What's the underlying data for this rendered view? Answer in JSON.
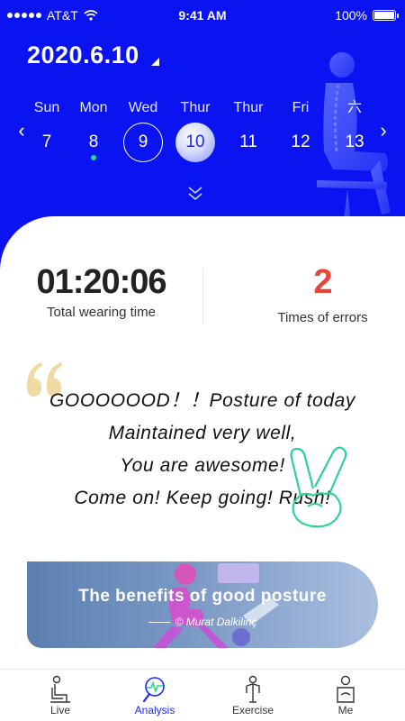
{
  "status_bar": {
    "carrier": "AT&T",
    "time": "9:41 AM",
    "battery": "100%"
  },
  "header": {
    "date": "2020.6.10",
    "prev_arrow": "‹",
    "next_arrow": "›",
    "days": [
      {
        "name": "Sun",
        "number": "7"
      },
      {
        "name": "Mon",
        "number": "8"
      },
      {
        "name": "Wed",
        "number": "9"
      },
      {
        "name": "Thur",
        "number": "10"
      },
      {
        "name": "Thur",
        "number": "11"
      },
      {
        "name": "Fri",
        "number": "12"
      },
      {
        "name": "六",
        "number": "13"
      }
    ]
  },
  "stats": {
    "wearing_time": {
      "value": "01:20:06",
      "label": "Total wearing time"
    },
    "errors": {
      "value": "2",
      "label": "Times of errors",
      "color": "#e9443a"
    }
  },
  "message": {
    "lines": [
      "GOOOOOOD！！Posture of today",
      "Maintained very well,",
      "You are awesome!",
      "Come on! Keep going! Rush!"
    ]
  },
  "banner": {
    "title": "The benefits of good posture",
    "author": "© Murat Dalkilinç"
  },
  "tabbar": {
    "tabs": [
      {
        "label": "Live",
        "icon": "seated-person-icon"
      },
      {
        "label": "Analysis",
        "icon": "analysis-magnifier-icon",
        "active": true
      },
      {
        "label": "Exercise",
        "icon": "standing-person-icon"
      },
      {
        "label": "Me",
        "icon": "profile-icon"
      }
    ]
  },
  "colors": {
    "primary": "#0a14f0",
    "accent_green": "#29d29a",
    "quote_gold": "#f1d9a3"
  }
}
